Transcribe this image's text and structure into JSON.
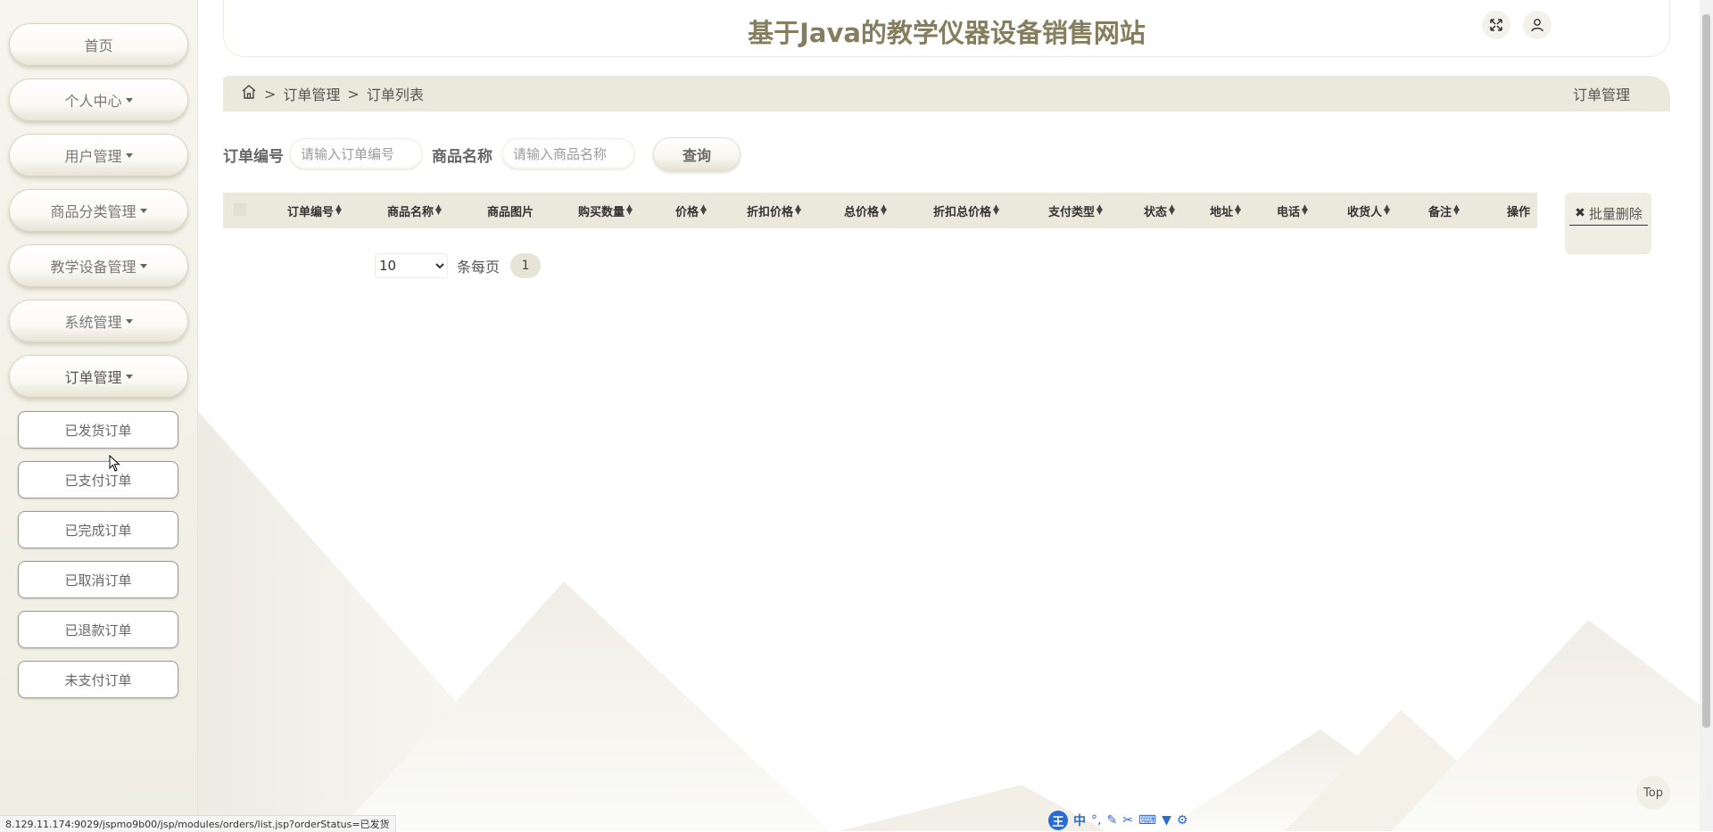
{
  "header": {
    "title": "基于Java的教学仪器设备销售网站",
    "fullscreen_icon": "fullscreen-icon",
    "user_icon": "user-icon"
  },
  "sidebar": {
    "items": [
      {
        "label": "首页",
        "has_caret": false
      },
      {
        "label": "个人中心",
        "has_caret": true
      },
      {
        "label": "用户管理",
        "has_caret": true
      },
      {
        "label": "商品分类管理",
        "has_caret": true
      },
      {
        "label": "教学设备管理",
        "has_caret": true
      },
      {
        "label": "系统管理",
        "has_caret": true
      },
      {
        "label": "订单管理",
        "has_caret": true
      }
    ],
    "subitems": [
      "已发货订单",
      "已支付订单",
      "已完成订单",
      "已取消订单",
      "已退款订单",
      "未支付订单"
    ]
  },
  "breadcrumb": {
    "home_icon": "home-icon",
    "sep": ">",
    "level1": "订单管理",
    "level2": "订单列表",
    "right": "订单管理"
  },
  "search": {
    "order_no_label": "订单编号",
    "order_no_placeholder": "请输入订单编号",
    "goods_name_label": "商品名称",
    "goods_name_placeholder": "请输入商品名称",
    "query_button": "查询"
  },
  "table": {
    "columns": [
      "订单编号",
      "商品名称",
      "商品图片",
      "购买数量",
      "价格",
      "折扣价格",
      "总价格",
      "折扣总价格",
      "支付类型",
      "状态",
      "地址",
      "电话",
      "收货人",
      "备注",
      "操作"
    ],
    "rows": []
  },
  "batch_delete": {
    "label": "批量删除",
    "icon": "close-icon"
  },
  "pagination": {
    "page_size": "10",
    "per_page_label": "条每页",
    "current_page": "1"
  },
  "status_bar": {
    "url": "8.129.11.174:9029/jspmo9b00/jsp/modules/orders/list.jsp?orderStatus=已发货"
  },
  "back_to_top": "Top",
  "ime": {
    "logo": "王",
    "mode": "中"
  },
  "colors": {
    "accent": "#857e5e",
    "bar": "#ebe9dc",
    "sidebar": "#f3f2ea"
  }
}
